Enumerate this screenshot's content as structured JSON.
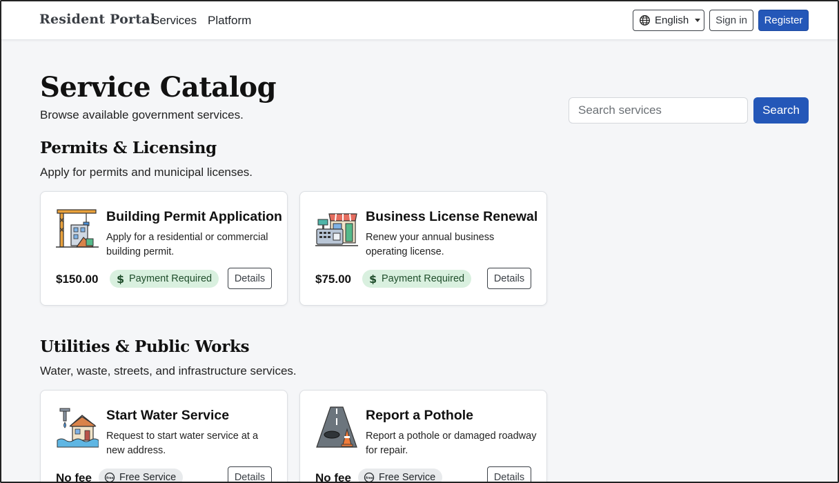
{
  "nav": {
    "brand": "Resident Portal",
    "links": [
      "Services",
      "Platform"
    ],
    "language": "English",
    "sign_in": "Sign in",
    "register": "Register"
  },
  "header": {
    "title": "Service Catalog",
    "subtitle": "Browse available government services.",
    "search_placeholder": "Search services",
    "search_button": "Search"
  },
  "colors": {
    "primary": "#2457b8",
    "paid_badge_bg": "#d9f0df",
    "free_badge_bg": "#e8eaec"
  },
  "sections": [
    {
      "title": "Permits & Licensing",
      "description": "Apply for permits and municipal licenses.",
      "cards": [
        {
          "icon": "construction-crane-icon",
          "title": "Building Permit Application",
          "description": "Apply for a residential or commercial building permit.",
          "price": "$150.00",
          "badge": "Payment Required",
          "badge_icon": "dollar-icon",
          "details": "Details"
        },
        {
          "icon": "storefront-register-icon",
          "title": "Business License Renewal",
          "description": "Renew your annual business operating license.",
          "price": "$75.00",
          "badge": "Payment Required",
          "badge_icon": "dollar-icon",
          "details": "Details"
        }
      ]
    },
    {
      "title": "Utilities & Public Works",
      "description": "Water, waste, streets, and infrastructure services.",
      "cards": [
        {
          "icon": "water-house-icon",
          "title": "Start Water Service",
          "description": "Request to start water service at a new address.",
          "price": "No fee",
          "badge": "Free Service",
          "badge_icon": "free-icon",
          "details": "Details"
        },
        {
          "icon": "road-pothole-icon",
          "title": "Report a Pothole",
          "description": "Report a pothole or damaged roadway for repair.",
          "price": "No fee",
          "badge": "Free Service",
          "badge_icon": "free-icon",
          "details": "Details"
        }
      ]
    }
  ]
}
